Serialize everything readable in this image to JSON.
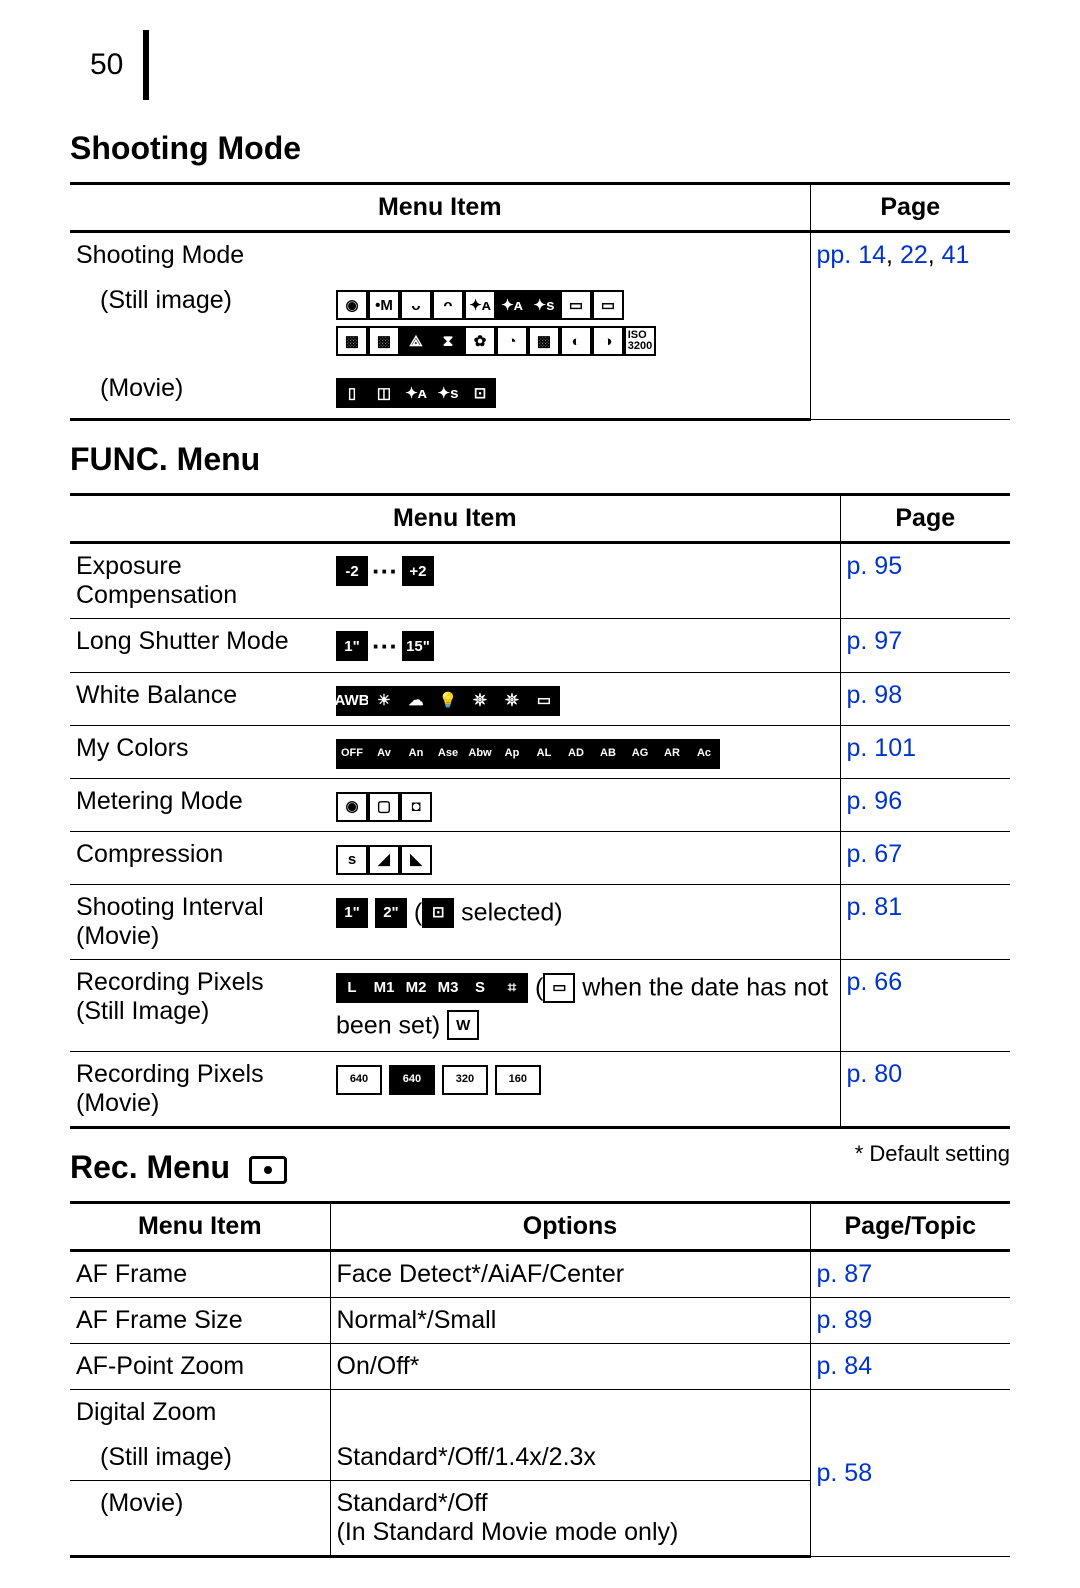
{
  "pageNumber": "50",
  "sections": {
    "shooting": {
      "title": "Shooting Mode",
      "headers": {
        "menuItem": "Menu Item",
        "page": "Page"
      },
      "rows": {
        "shootingMode": {
          "label": "Shooting Mode",
          "page": "pp. 14, 22, 41"
        },
        "stillImage": {
          "label": "(Still image)"
        },
        "movie": {
          "label": "(Movie)"
        }
      },
      "iconNames": {
        "stillRow1": [
          "auto",
          "manual",
          "portrait",
          "landscape",
          "night-scene",
          "night-snap",
          "night-snap-s",
          "pets",
          "kids"
        ],
        "stillRow2": [
          "indoor",
          "foliage",
          "snow",
          "beach",
          "fireworks",
          "aquarium",
          "underwater",
          "color-accent",
          "color-swap",
          "iso3200"
        ],
        "movie": [
          "standard",
          "compact",
          "night",
          "night-s",
          "timelapse"
        ]
      }
    },
    "func": {
      "title": "FUNC. Menu",
      "headers": {
        "menuItem": "Menu Item",
        "page": "Page"
      },
      "rows": {
        "exposure": {
          "label": "Exposure Compensation",
          "iconsText": {
            "left": "-2",
            "right": "+2"
          },
          "page": "p. 95"
        },
        "longShutter": {
          "label": "Long Shutter Mode",
          "iconsText": {
            "left": "1\"",
            "right": "15\""
          },
          "page": "p. 97"
        },
        "whiteBalance": {
          "label": "White Balance",
          "iconLabels": [
            "AWB",
            "☀",
            "☁",
            "💡",
            "𖤓",
            "𖤓",
            "▭"
          ],
          "page": "p. 98"
        },
        "myColors": {
          "label": "My Colors",
          "iconLabels": [
            "OFF",
            "Av",
            "An",
            "Ase",
            "Abw",
            "Ap",
            "AL",
            "AD",
            "AB",
            "AG",
            "AR",
            "Ac"
          ],
          "page": "p. 101"
        },
        "metering": {
          "label": "Metering Mode",
          "iconNames": [
            "evaluative",
            "center-weighted",
            "spot"
          ],
          "page": "p. 96"
        },
        "compression": {
          "label": "Compression",
          "iconNames": [
            "superfine",
            "fine",
            "normal"
          ],
          "page": "p. 67"
        },
        "interval": {
          "labelLine1": "Shooting Interval",
          "labelLine2": "(Movie)",
          "iconsText": {
            "a": "1\"",
            "b": "2\""
          },
          "trailing": " selected)",
          "leadParen": " (",
          "page": "p. 81"
        },
        "recPixStill": {
          "labelLine1": "Recording Pixels",
          "labelLine2": "(Still Image)",
          "iconLabels": [
            "L",
            "M1",
            "M2",
            "M3",
            "S",
            "⌗"
          ],
          "trailing1": " when the date has not been set) ",
          "leadParen": " (",
          "trailingIcon": "W",
          "page": "p. 66"
        },
        "recPixMovie": {
          "labelLine1": "Recording Pixels",
          "labelLine2": "(Movie)",
          "iconLabels": [
            "640",
            "640",
            "320",
            "160"
          ],
          "page": "p. 80"
        }
      }
    },
    "rec": {
      "title": "Rec. Menu",
      "defaultNote": "* Default setting",
      "headers": {
        "menuItem": "Menu Item",
        "options": "Options",
        "page": "Page/Topic"
      },
      "rows": {
        "afFrame": {
          "label": "AF Frame",
          "options": "Face Detect*/AiAF/Center",
          "page": "p. 87"
        },
        "afFrameSize": {
          "label": "AF Frame Size",
          "options": "Normal*/Small",
          "page": "p. 89"
        },
        "afPointZoom": {
          "label": "AF-Point Zoom",
          "options": "On/Off*",
          "page": "p. 84"
        },
        "digitalZoom": {
          "label": "Digital Zoom",
          "page": "p. 58"
        },
        "dzStill": {
          "label": "(Still image)",
          "options": "Standard*/Off/1.4x/2.3x"
        },
        "dzMovie": {
          "label": "(Movie)",
          "optionsLine1": "Standard*/Off",
          "optionsLine2": "(In Standard Movie mode only)"
        }
      }
    }
  }
}
